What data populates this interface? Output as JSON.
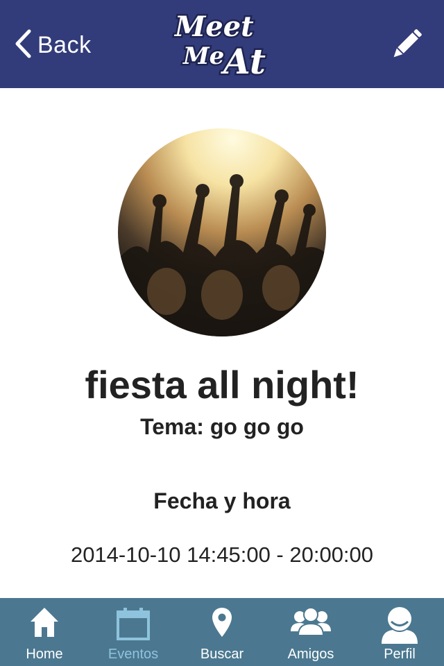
{
  "navbar": {
    "back_label": "Back",
    "logo_line1": "Meet",
    "logo_line2": "Me",
    "logo_line3": "At",
    "background_color": "#333c7a"
  },
  "event": {
    "title": "fiesta all night!",
    "theme": "Tema: go go go",
    "date_heading": "Fecha y hora",
    "date_value": "2014-10-10 14:45:00 - 20:00:00"
  },
  "tabbar": {
    "background_color": "#4b7890",
    "active_color": "#8fc3dd",
    "items": [
      {
        "label": "Home",
        "icon": "home-icon"
      },
      {
        "label": "Eventos",
        "icon": "calendar-icon",
        "active": true
      },
      {
        "label": "Buscar",
        "icon": "map-pin-icon"
      },
      {
        "label": "Amigos",
        "icon": "friends-icon"
      },
      {
        "label": "Perfil",
        "icon": "user-icon"
      }
    ]
  }
}
